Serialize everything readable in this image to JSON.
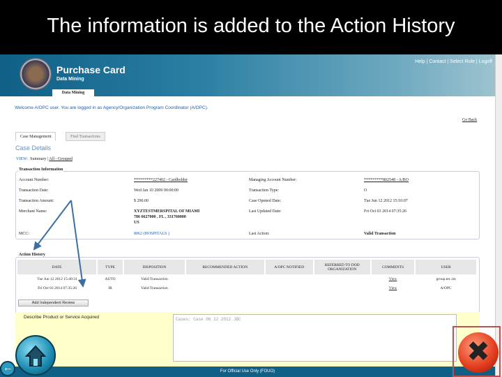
{
  "slide_title": "The information is added to the Action History",
  "header": {
    "app_title": "Purchase Card",
    "subtitle": "Data Mining",
    "links": "Help | Contact | Select Role | Logoff",
    "tab": "Data Mining"
  },
  "welcome": "Welcome A/OPC user. You are logged in as Agency/Organization Program Coordinator (A/OPC).",
  "go_back": "Go Back",
  "tabs": [
    "Case Management",
    "Find Transactions"
  ],
  "case_details": "Case Details",
  "view": {
    "label": "VIEW:",
    "summary": "Summary",
    "sep": "|",
    "all": "All - Grouped"
  },
  "transaction_info": {
    "legend": "Transaction Information",
    "rows": [
      [
        "Account Number:",
        "*********227402 - Cardholder",
        "Managing Account Number:",
        "*********802548 - A/BO"
      ],
      [
        "Transaction Date:",
        "Wed Jan 10 2009 00:00:00",
        "Transaction Type:",
        "O"
      ],
      [
        "Transaction Amount:",
        "$ 290.00",
        "Case Opened Date:",
        "Tue Jun 12 2012 15:10:07"
      ],
      [
        "Merchant Name:",
        "XYZTESTMERSPITAL OF MIAMI\n786 6627000 , FL , 331760000\nUS",
        "Last Updated Date:",
        "Fri Oct 03 2014 07:35:26"
      ],
      [
        "MCC:",
        "8062 (HOSPITALS )",
        "Last Action:",
        "Valid Transaction"
      ]
    ]
  },
  "action_history": {
    "legend": "Action History",
    "columns": [
      "DATE",
      "TYPE",
      "DISPOSITION",
      "RECOMMENDED ACTION",
      "A/OPC NOTIFIED",
      "REFERRED TO DOD ORGANIZATION",
      "COMMENTS",
      "USER"
    ],
    "rows": [
      [
        "Tue Jun 12 2012 15:40:31",
        "AUTO",
        "Valid Transaction",
        "",
        "",
        "",
        "View",
        "group.ter..im"
      ],
      [
        "Fri Oct 03 2014 07:35:26",
        "IR",
        "Valid Transaction",
        "",
        "",
        "",
        "View",
        "A/OPC"
      ]
    ],
    "button": "Add Independent Review"
  },
  "describe": {
    "label": "Describe Product or Service Acquired",
    "value": "Cases: Case   06 12 2012 JBC"
  },
  "footer": "For Official Use Only (FOUO)",
  "colors": {
    "header": "#0f5f86",
    "accent_link": "#1a5fb4",
    "arrow": "#3b6ea5",
    "highlight_box": "#c05050"
  }
}
